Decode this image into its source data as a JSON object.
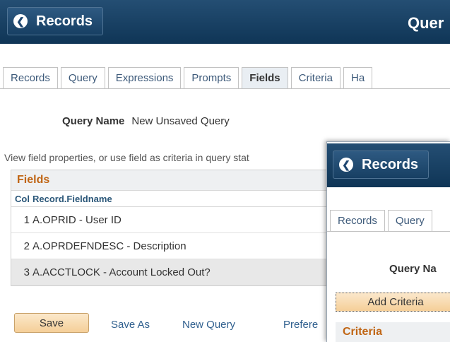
{
  "back_window": {
    "back_button_label": "Records",
    "title": "Quer",
    "tabs": [
      "Records",
      "Query",
      "Expressions",
      "Prompts",
      "Fields",
      "Criteria",
      "Ha"
    ],
    "active_tab": "Fields",
    "query_name_label": "Query Name",
    "query_name_value": "New Unsaved Query",
    "info_text": "View field properties, or use field as criteria in query stat",
    "grid": {
      "title": "Fields",
      "columns": [
        "Col",
        "Record.Fieldname"
      ],
      "rows": [
        {
          "col": "1",
          "field": "A.OPRID - User ID"
        },
        {
          "col": "2",
          "field": "A.OPRDEFNDESC - Description"
        },
        {
          "col": "3",
          "field": "A.ACCTLOCK - Account Locked Out?"
        }
      ]
    },
    "footer": {
      "save_label": "Save",
      "save_as_label": "Save As",
      "new_query_label": "New Query",
      "preferences_label": "Prefere"
    }
  },
  "front_window": {
    "back_button_label": "Records",
    "tabs": [
      "Records",
      "Query"
    ],
    "query_name_label": "Query Na",
    "add_criteria_label": "Add Criteria",
    "criteria_title": "Criteria"
  }
}
